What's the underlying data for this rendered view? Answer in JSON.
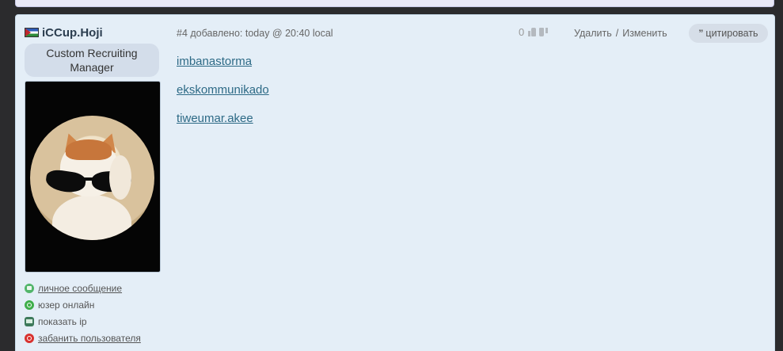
{
  "post": {
    "number": "#4",
    "added_label": "добавлено:",
    "timestamp": "today @ 20:40 local",
    "rating_count": "0",
    "delete_label": "Удалить",
    "separator": "/",
    "edit_label": "Изменить",
    "quote_label": "цитировать",
    "quote_icon": "quote-icon",
    "body_links": [
      "imbanastorma",
      "ekskommunikado",
      "tiweumar.akee"
    ]
  },
  "author": {
    "name": "iCCup.Hoji",
    "flag_icon": "flag-icon",
    "role": "Custom Recruiting Manager"
  },
  "actions": [
    {
      "label": "личное сообщение",
      "icon": "message-icon",
      "color": "#52b56a"
    },
    {
      "label": "юзер онлайн",
      "icon": "online-icon",
      "color": "#3fae4a"
    },
    {
      "label": "показать ip",
      "icon": "ip-icon",
      "color": "#3e7a5b"
    },
    {
      "label": "забанить пользователя",
      "icon": "ban-icon",
      "color": "#d8322f"
    }
  ],
  "colors": {
    "post_bg": "#e4eef7",
    "link": "#2d6a86",
    "page_bg": "#2b2b2d"
  }
}
